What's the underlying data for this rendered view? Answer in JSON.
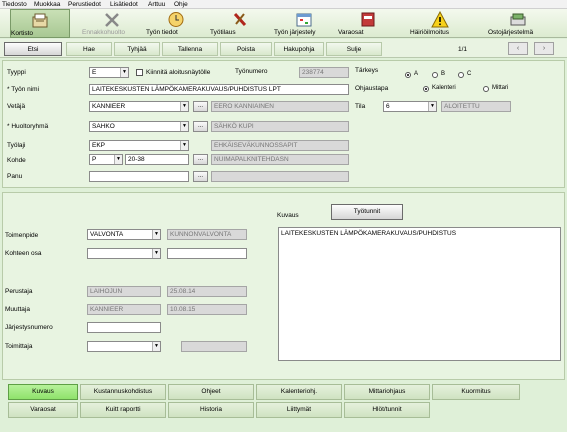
{
  "menu": [
    "Tiedosto",
    "Muokkaa",
    "Perustiedot",
    "Lisätiedot",
    "Arttuu",
    "Ohje"
  ],
  "toolbar": [
    {
      "label": "Kortisto",
      "icon": "card-file-icon",
      "active": true,
      "disabled": false
    },
    {
      "label": "Ennakkohuolto",
      "icon": "wrench-tools-icon",
      "active": false,
      "disabled": true
    },
    {
      "label": "Työn tiedot",
      "icon": "clock-icon",
      "active": false,
      "disabled": false
    },
    {
      "label": "Työtilaus",
      "icon": "tools-icon",
      "active": false,
      "disabled": false
    },
    {
      "label": "Työn järjestely",
      "icon": "calendar-icon",
      "active": false,
      "disabled": false
    },
    {
      "label": "Varaosat",
      "icon": "parts-icon",
      "active": false,
      "disabled": false
    },
    {
      "label": "Häiriöilmoitus",
      "icon": "warning-icon",
      "active": false,
      "disabled": false
    },
    {
      "label": "Ostojärjestelmä",
      "icon": "purchase-icon",
      "active": false,
      "disabled": false
    }
  ],
  "actions": {
    "etsi": "Etsi",
    "hae": "Hae",
    "tyhjaa": "Tyhjää",
    "tallenna": "Tallenna",
    "poista": "Poista",
    "hakupohja": "Hakupohja",
    "sulje": "Sulje",
    "pager": "1/1",
    "prev": "‹",
    "next": "›"
  },
  "form": {
    "tyyppi": {
      "label": "Tyyppi",
      "value": "E"
    },
    "kiinnita": {
      "label": "Kiinnitä aloitusnäytölle"
    },
    "tyonumero": {
      "label": "Työnumero",
      "value": "238774"
    },
    "tarkeys": {
      "label": "Tärkeys",
      "options": [
        "A",
        "B",
        "C"
      ],
      "selected": "A"
    },
    "tyon_nimi": {
      "label": "* Työn nimi",
      "value": "LAITEKESKUSTEN LÄMPÖKAMERAKUVAUS/PUHDISTUS LPT"
    },
    "ohjaustapa": {
      "label": "Ohjaustapa",
      "options": [
        "Kalenteri",
        "Mittari"
      ],
      "selected": "Kalenteri"
    },
    "vetaja": {
      "label": "Vetäjä",
      "value": "KANNIEER",
      "name": "EERO KANNIAINEN"
    },
    "tila": {
      "label": "Tila",
      "code": "6",
      "value": "ALOITETTU"
    },
    "huoltoryhma": {
      "label": "* Huoltoryhmä",
      "value": "SAHKO",
      "name": "SÄHKÖ KUPI"
    },
    "tyolaji": {
      "label": "Työlaji",
      "value": "EKP",
      "name": "EHKÄISEVÄKUNNOSSAPIT"
    },
    "kohde": {
      "label": "Kohde",
      "value": "P",
      "code": "20-38",
      "name": "NUIMAPALKNITEHDASN"
    },
    "panu": {
      "label": "Panu"
    }
  },
  "detail": {
    "kuvaus_label": "Kuvaus",
    "tyotunnit": "Työtunnit",
    "kuvaus_text": "LAITEKESKUSTEN LÄMPÖKAMERAKUVAUS/PUHDISTUS",
    "toimenpide": {
      "label": "Toimenpide",
      "value": "VALVONTA",
      "name": "KUNNONVALVONTA"
    },
    "kohteen_osa": {
      "label": "Kohteen osa"
    },
    "perustaja": {
      "label": "Perustaja",
      "value": "LAIHOJUN",
      "date": "25.08.14"
    },
    "muuttaja": {
      "label": "Muuttaja",
      "value": "KANNIEER",
      "date": "10.08.15"
    },
    "jarjestysnumero": {
      "label": "Järjestysnumero"
    },
    "toimittaja": {
      "label": "Toimittaja"
    }
  },
  "tabs_row1": [
    "Kuvaus",
    "Kustannuskohdistus",
    "Ohjeet",
    "Kalenteriohj.",
    "Mittariohjaus",
    "Kuormitus"
  ],
  "tabs_row2": [
    "Varaosat",
    "Kuitt raportti",
    "Historia",
    "Liittymät",
    "Hlöt/tunnit"
  ],
  "colors": {
    "active_tab": "#8fe26b",
    "background": "#dff0d8"
  }
}
